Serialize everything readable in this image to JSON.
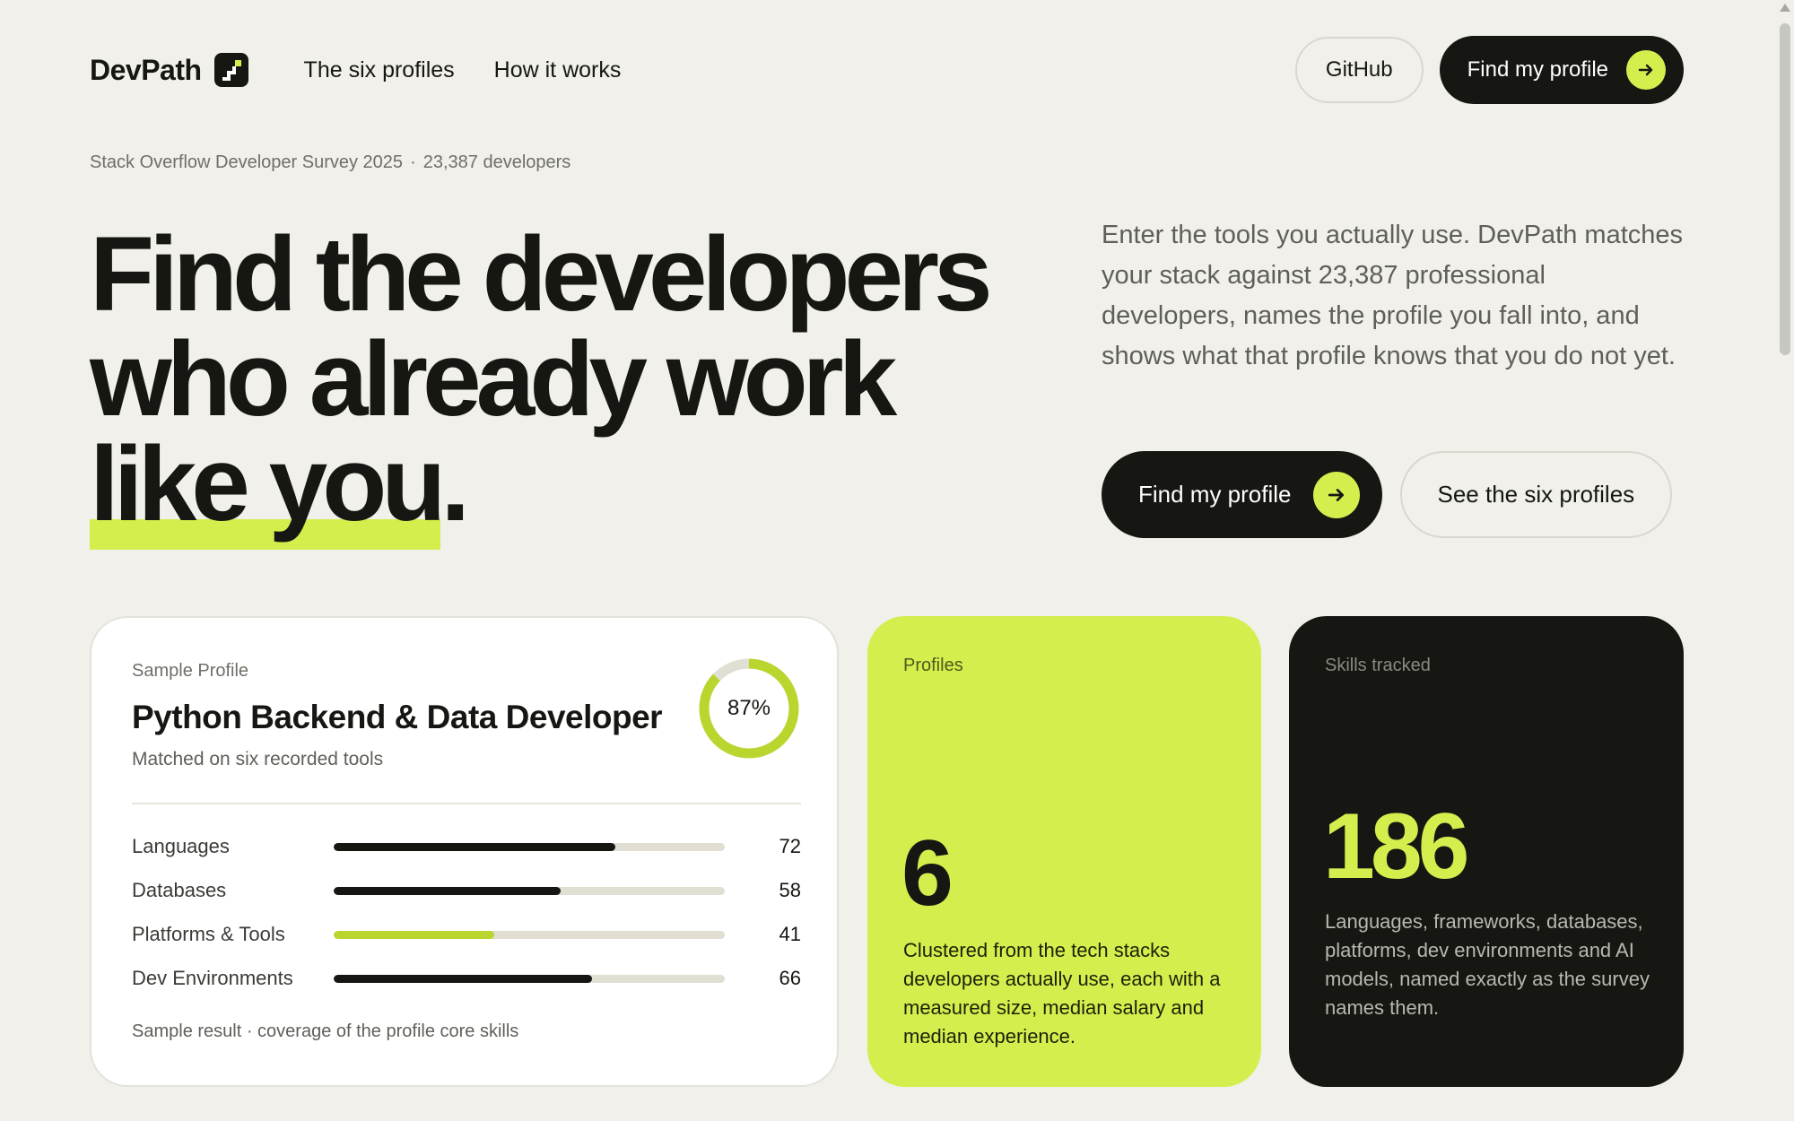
{
  "nav": {
    "brand": "DevPath",
    "links": [
      "The six profiles",
      "How it works"
    ],
    "github_label": "GitHub",
    "cta_label": "Find my profile"
  },
  "hero": {
    "eyebrow_source": "Stack Overflow Developer Survey 2025",
    "eyebrow_separator": "·",
    "eyebrow_count": "23,387 developers",
    "headline_line1": "Find the developers",
    "headline_line2": "who already work",
    "headline_highlight": "like you",
    "headline_period": ".",
    "intro": "Enter the tools you actually use. DevPath matches your stack against 23,387 professional developers, names the profile you fall into, and shows what that profile knows that you do not yet.",
    "primary_cta": "Find my profile",
    "secondary_cta": "See the six profiles"
  },
  "profile_card": {
    "label": "Sample Profile",
    "title": "Python Backend & Data Developer",
    "subtitle": "Matched on six recorded tools",
    "match_value": 0.87,
    "match_label": "87%",
    "skills": [
      {
        "name": "Languages",
        "value": "72",
        "fraction": 0.72,
        "color": "#161712"
      },
      {
        "name": "Databases",
        "value": "58",
        "fraction": 0.58,
        "color": "#161712"
      },
      {
        "name": "Platforms & Tools",
        "value": "41",
        "fraction": 0.41,
        "color": "#b9d62f"
      },
      {
        "name": "Dev Environments",
        "value": "66",
        "fraction": 0.66,
        "color": "#161712"
      }
    ],
    "footer": "Sample result · coverage of the profile core skills"
  },
  "stats": {
    "profiles": {
      "label": "Profiles",
      "number": "6",
      "description": "Clustered from the tech stacks developers actually use, each with a measured size, median salary and median experience."
    },
    "skills": {
      "label": "Skills tracked",
      "number": "186",
      "description": "Languages, frameworks, databases, platforms, dev environments and AI models, named exactly as the survey names them."
    }
  },
  "colors": {
    "background": "#f1f0eb",
    "ink": "#161712",
    "accent": "#d4ee4e",
    "accent_dark": "#b9d62f"
  },
  "icons": {
    "logo": "stairs-icon",
    "cta_arrow": "arrow-right-icon"
  }
}
